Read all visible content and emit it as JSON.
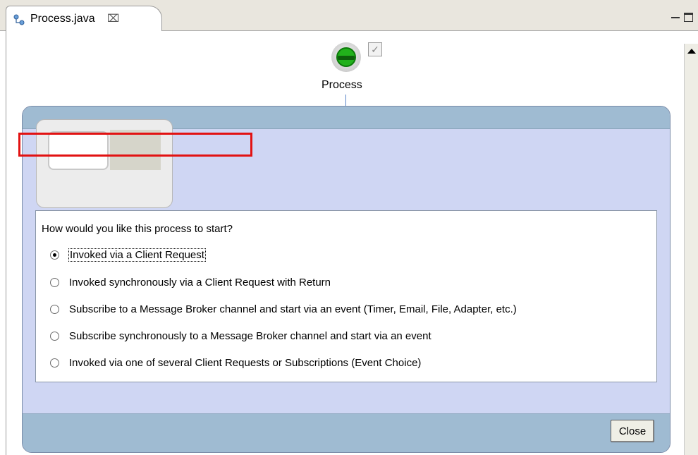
{
  "tab": {
    "title": "Process.java",
    "close_glyph": "⌧"
  },
  "node": {
    "label": "Process",
    "check_glyph": "✓"
  },
  "dialog": {
    "question": "How would you like this process to start?",
    "options": [
      {
        "label": "Invoked via a Client Request",
        "selected": true
      },
      {
        "label": "Invoked synchronously via a Client Request with Return",
        "selected": false
      },
      {
        "label": "Subscribe to a Message Broker channel and start via an event (Timer, Email, File, Adapter, etc.)",
        "selected": false
      },
      {
        "label": "Subscribe synchronously to a Message Broker channel and start via an event",
        "selected": false
      },
      {
        "label": "Invoked via one of several Client Requests or Subscriptions (Event Choice)",
        "selected": false
      }
    ],
    "close_label": "Close"
  },
  "colors": {
    "highlight": "#e21212",
    "panel": "#cfd6f3",
    "panel_bar": "#9fbbd2",
    "node_green": "#21b11b"
  },
  "icons": {
    "tab": "process-diagram-icon",
    "scroll_up": "scroll-up-arrow-icon"
  }
}
